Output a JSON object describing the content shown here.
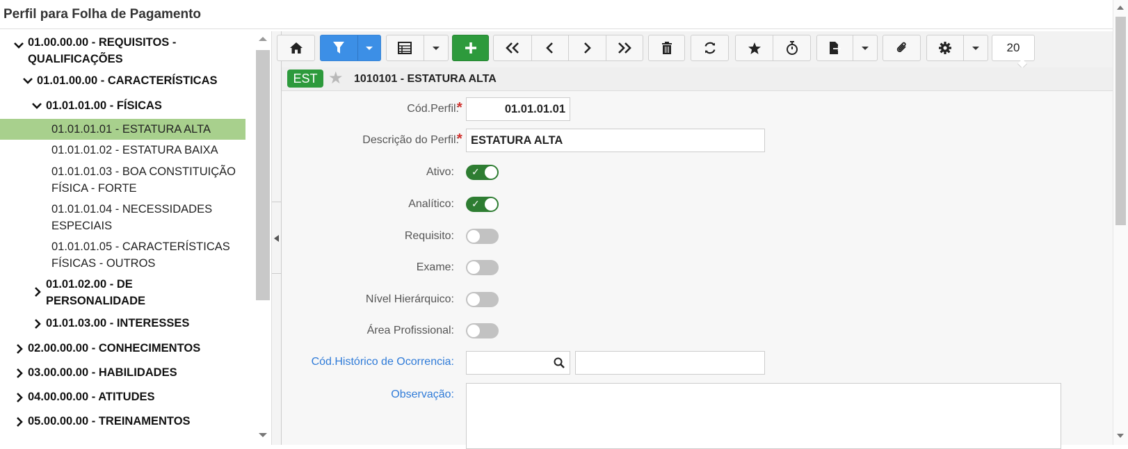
{
  "page_title": "Perfil para Folha de Pagamento",
  "tree": {
    "nodes": [
      {
        "label": "01.00.00.00 - REQUISITOS - QUALIFICAÇÕES",
        "state": "expanded",
        "level": 0
      },
      {
        "label": "01.01.00.00 - CARACTERÍSTICAS",
        "state": "expanded",
        "level": 1
      },
      {
        "label": "01.01.01.00 - FÍSICAS",
        "state": "expanded",
        "level": 2
      },
      {
        "label": "01.01.01.01 - ESTATURA ALTA",
        "state": "leaf",
        "level": 3,
        "selected": true
      },
      {
        "label": "01.01.01.02 - ESTATURA BAIXA",
        "state": "leaf",
        "level": 3
      },
      {
        "label": "01.01.01.03 - BOA CONSTITUIÇÃO FÍSICA - FORTE",
        "state": "leaf",
        "level": 3
      },
      {
        "label": "01.01.01.04 - NECESSIDADES ESPECIAIS",
        "state": "leaf",
        "level": 3
      },
      {
        "label": "01.01.01.05 - CARACTERÍSTICAS FÍSICAS - OUTROS",
        "state": "leaf",
        "level": 3
      },
      {
        "label": "01.01.02.00 - DE PERSONALIDADE",
        "state": "collapsed",
        "level": 2
      },
      {
        "label": "01.01.03.00 - INTERESSES",
        "state": "collapsed",
        "level": 2
      },
      {
        "label": "02.00.00.00 - CONHECIMENTOS",
        "state": "collapsed",
        "level": 0
      },
      {
        "label": "03.00.00.00 - HABILIDADES",
        "state": "collapsed",
        "level": 0
      },
      {
        "label": "04.00.00.00 - ATITUDES",
        "state": "collapsed",
        "level": 0
      },
      {
        "label": "05.00.00.00 - TREINAMENTOS",
        "state": "collapsed",
        "level": 0
      }
    ]
  },
  "toolbar": {
    "icons": [
      "home-icon",
      "filter-icon",
      "grid-icon",
      "plus-icon",
      "first-icon",
      "prev-icon",
      "next-icon",
      "last-icon",
      "trash-icon",
      "refresh-icon",
      "star-icon",
      "stopwatch-icon",
      "export-icon",
      "paperclip-icon",
      "gear-icon"
    ],
    "page_size": "20"
  },
  "record": {
    "tag": "EST",
    "title": "1010101 - ESTATURA ALTA"
  },
  "form": {
    "cod_perfil_label": "Cód.Perfil:",
    "cod_perfil_value": "01.01.01.01",
    "descricao_label": "Descrição do Perfil:",
    "descricao_value": "ESTATURA ALTA",
    "ativo_label": "Ativo:",
    "ativo_value": true,
    "analitico_label": "Analítico:",
    "analitico_value": true,
    "requisito_label": "Requisito:",
    "requisito_value": false,
    "exame_label": "Exame:",
    "exame_value": false,
    "nivel_label": "Nível Hierárquico:",
    "nivel_value": false,
    "area_label": "Área Profissional:",
    "area_value": false,
    "cod_hist_label": "Cód.Histórico de Ocorrencia:",
    "cod_hist_value": "",
    "cod_hist_desc": "",
    "observacao_label": "Observação:",
    "observacao_value": ""
  },
  "colors": {
    "accent_blue": "#3c8fe6",
    "accent_green": "#2d9a3c",
    "selected_row": "#a8d08d",
    "toggle_on": "#2e7d32",
    "required": "#d0312d",
    "link": "#2f7bd8"
  }
}
